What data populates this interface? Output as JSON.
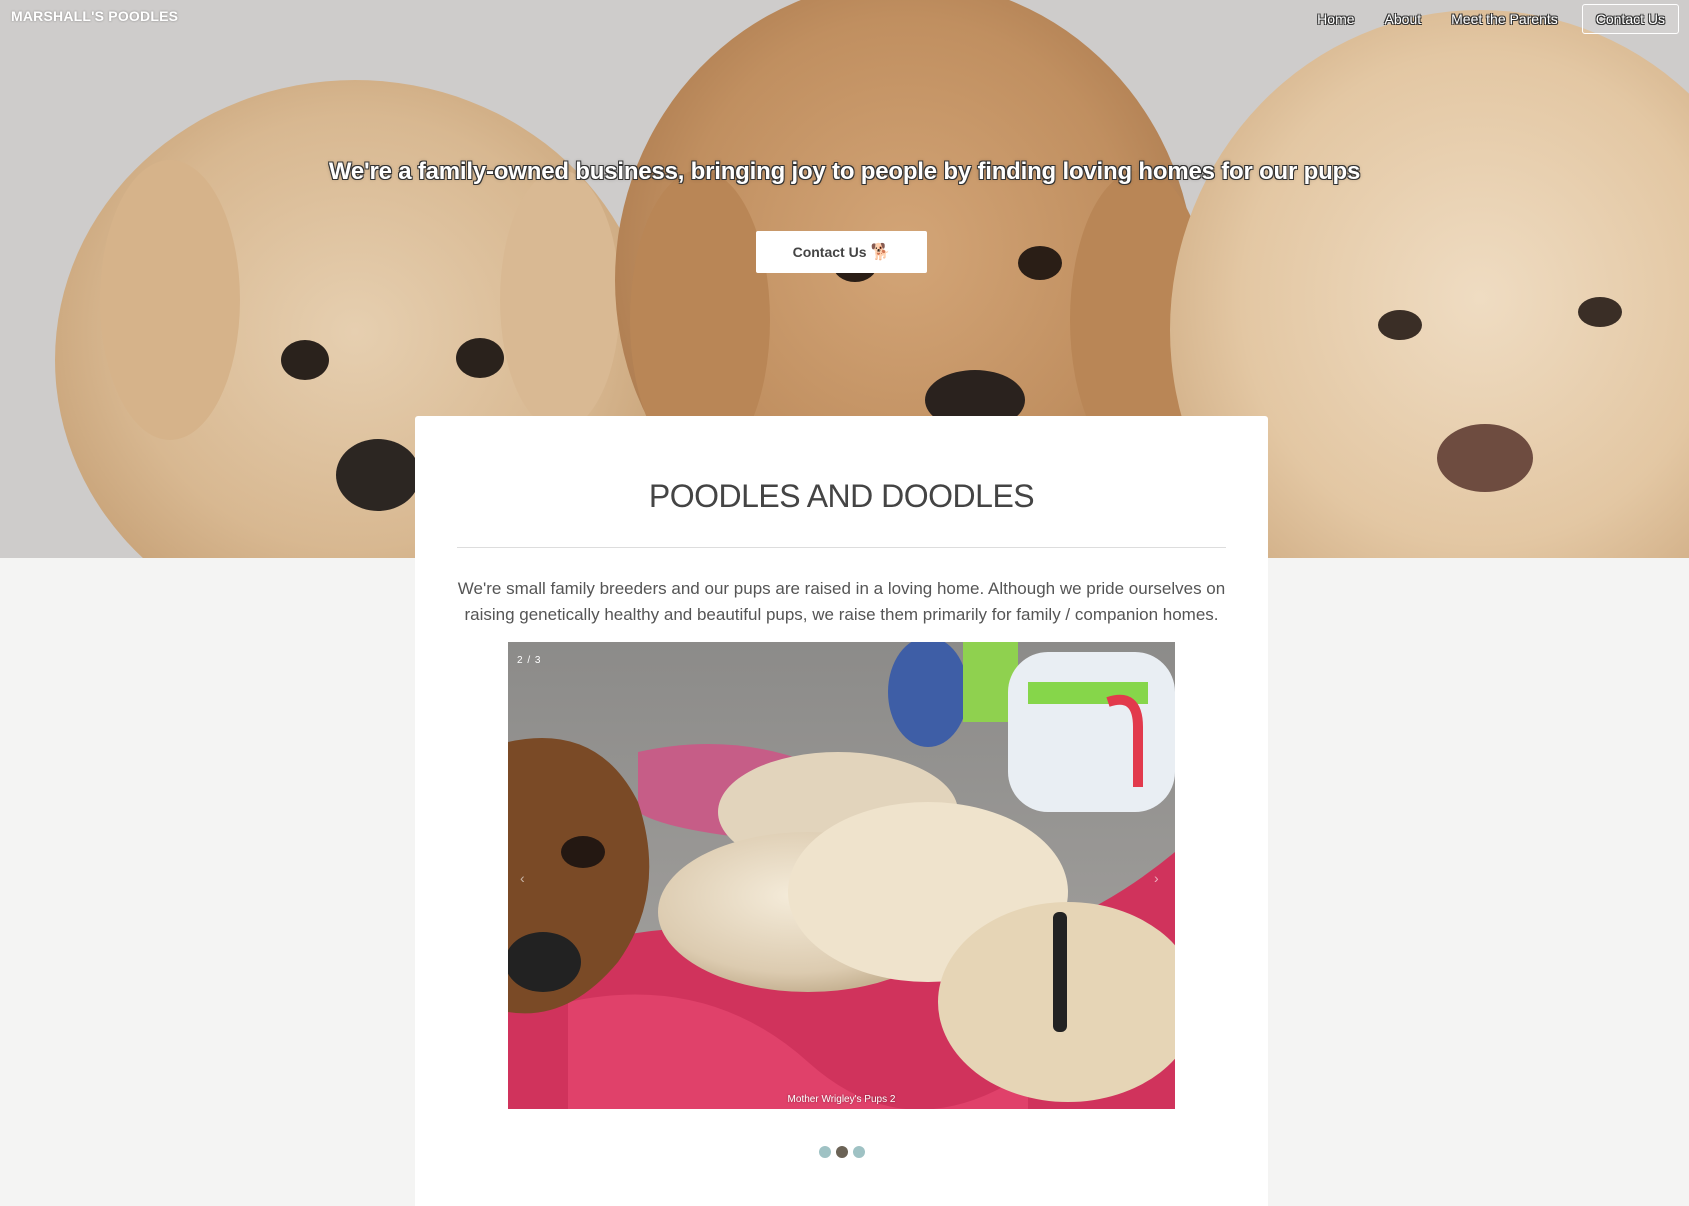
{
  "header": {
    "brand": "MARSHALL'S POODLES",
    "nav": [
      {
        "label": "Home"
      },
      {
        "label": "About"
      },
      {
        "label": "Meet the Parents"
      },
      {
        "label": "Contact Us"
      }
    ]
  },
  "hero": {
    "headline": "We're a family-owned business, bringing joy to people by finding loving homes for our pups",
    "cta_label": "Contact Us",
    "cta_icon": "🐕"
  },
  "section": {
    "title": "POODLES AND DOODLES",
    "description": "We're small family breeders and our pups are raised in a loving home. Although we pride ourselves on raising genetically healthy and beautiful pups, we raise them primarily for family / companion homes."
  },
  "carousel": {
    "counter": "2 / 3",
    "caption": "Mother Wrigley's Pups 2",
    "prev_icon": "‹",
    "next_icon": "›",
    "total": 3,
    "active_index": 1
  },
  "colors": {
    "dot_inactive": "#9fc2c4",
    "dot_active": "#6b6356",
    "page_background": "#f4f4f3"
  }
}
